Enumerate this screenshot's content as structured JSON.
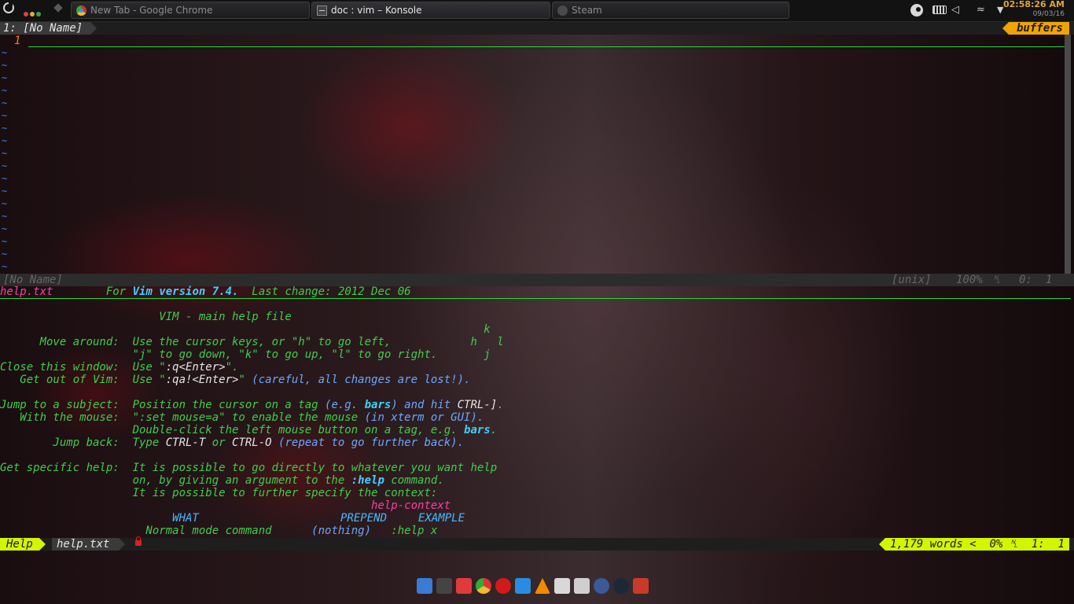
{
  "taskbar": {
    "tasks": [
      {
        "label": "New Tab - Google Chrome"
      },
      {
        "label": "doc : vim – Konsole"
      },
      {
        "label": "Steam"
      }
    ],
    "clock": {
      "time": "02:58:26 AM",
      "date": "09/03/16"
    },
    "tray_icons": [
      "steam-icon",
      "keyboard-icon",
      "volume-icon",
      "wifi-icon",
      "menu-arrow-icon"
    ]
  },
  "vim": {
    "tabline": {
      "current": "1: [No Name]",
      "right": "buffers"
    },
    "top_window": {
      "line_number": "1",
      "tilde": "~"
    },
    "status1": {
      "name": "[No Name]",
      "format": "[unix]",
      "percent": "100%",
      "ln": "␤",
      "pos": "0:  1"
    },
    "help_header": {
      "tag": "help.txt",
      "for": "For ",
      "version": "Vim version 7.4.",
      "last_change": "  Last change: 2012 Dec 06"
    },
    "help_lines": {
      "title": "                        VIM - main help file",
      "k": "                                                                         k",
      "move_a": "      Move around:  Use the cursor keys, or \"h\" to go left,            h   l",
      "move_b": "                    \"j\" to go down, \"k\" to go up, \"l\" to go right.       j",
      "close_a": "Close this window:  Use \"",
      "close_cmd": ":q<Enter>",
      "close_b": "\".",
      "getout_a": "   Get out of Vim:  Use \"",
      "getout_cmd": ":qa!<Enter>",
      "getout_b": "\" ",
      "getout_c": "(careful, all changes are lost!).",
      "jump_a": "Jump to a subject:  Position the cursor on a tag ",
      "jump_b": "(e.g. ",
      "jump_bars": "bars",
      "jump_c": ") and hit ",
      "jump_key": "CTRL-]",
      "jump_d": ".",
      "mouse_a": "   With the mouse:  \":set mouse=a\" to enable the mouse ",
      "mouse_b": "(in xterm or GUI).",
      "dbl_a": "                    Double-click the left mouse button on a tag, e.g. ",
      "dbl_bars": "bars",
      "dbl_b": ".",
      "back_a": "        Jump back:  Type ",
      "back_k1": "CTRL-T",
      "back_b": " or ",
      "back_k2": "CTRL-O",
      "back_c": " ",
      "back_d": "(repeat to go further back).",
      "spec_a": "Get specific help:  It is possible to go directly to whatever you want help",
      "spec_b1": "                    on, by giving an argument to the ",
      "spec_help": ":help",
      "spec_b2": " command.",
      "spec_c": "                    It is possible to further specify the context:",
      "ctx": "                                                        help-context",
      "hdr_what": "                          WHAT",
      "hdr_prepend": "PREPEND",
      "hdr_example": "EXAMPLE",
      "row_a": "                      Normal mode command      ",
      "row_b": "(nothing)",
      "row_c": "   :help x"
    },
    "status2": {
      "mode": "Help",
      "file": "help.txt",
      "words": "1,179 words",
      "percent": "0%",
      "ln": "␤",
      "pos": "1:  1"
    }
  },
  "dock": {
    "icons": [
      "files-icon",
      "terminal-icon",
      "vivaldi-icon",
      "chrome-icon",
      "opera-icon",
      "monitor-icon",
      "vlc-icon",
      "media-icon",
      "folder-icon",
      "headphones-icon",
      "steam-icon",
      "gmail-icon"
    ],
    "colors": {
      "files": "#3a7bd5",
      "terminal": "#444444",
      "vivaldi": "#e03a3a",
      "chrome": "#e8b820",
      "opera": "#d21a1a",
      "monitor": "#2a8ce0",
      "vlc": "#f08a00",
      "media": "#d8d8d8",
      "folder": "#cfcfcf",
      "headphones": "#3a5a9a",
      "steam": "#1b2838",
      "gmail": "#c83a2a"
    }
  }
}
